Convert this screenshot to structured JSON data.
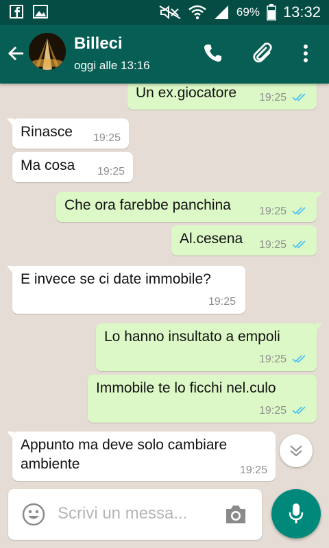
{
  "status_bar": {
    "battery": "69%",
    "time": "13:32"
  },
  "header": {
    "contact_name": "Billeci",
    "last_seen": "oggi alle 13:16"
  },
  "messages": [
    {
      "dir": "out",
      "text": "Un ex.giocatore",
      "time": "19:25"
    },
    {
      "dir": "in",
      "text": "Rinasce",
      "time": "19:25"
    },
    {
      "dir": "in",
      "text": "Ma cosa",
      "time": "19:25"
    },
    {
      "dir": "out",
      "text": "Che ora farebbe panchina",
      "time": "19:25"
    },
    {
      "dir": "out",
      "text": "Al.cesena",
      "time": "19:25"
    },
    {
      "dir": "in",
      "text": "E invece se ci date immobile?",
      "time": "19:25"
    },
    {
      "dir": "out",
      "text": "Lo hanno insultato a empoli",
      "time": "19:25"
    },
    {
      "dir": "out",
      "text": "Immobile te lo ficchi nel.culo",
      "time": "19:25"
    },
    {
      "dir": "in",
      "text": "Appunto ma deve solo cambiare ambiente",
      "time": "19:25"
    }
  ],
  "composer": {
    "placeholder": "Scrivi un messa..."
  },
  "colors": {
    "header": "#075e54",
    "status_bar": "#054d44",
    "outgoing": "#dcf8c6",
    "incoming": "#ffffff",
    "read_ticks": "#4fc3f7",
    "fab": "#00897b"
  },
  "icons": [
    "facebook-icon",
    "gallery-icon",
    "mute-icon",
    "wifi-icon",
    "signal-icon",
    "battery-icon",
    "back-arrow-icon",
    "phone-icon",
    "attach-icon",
    "more-icon",
    "double-check-icon",
    "chevron-down-icon",
    "emoji-icon",
    "camera-icon",
    "mic-icon"
  ]
}
